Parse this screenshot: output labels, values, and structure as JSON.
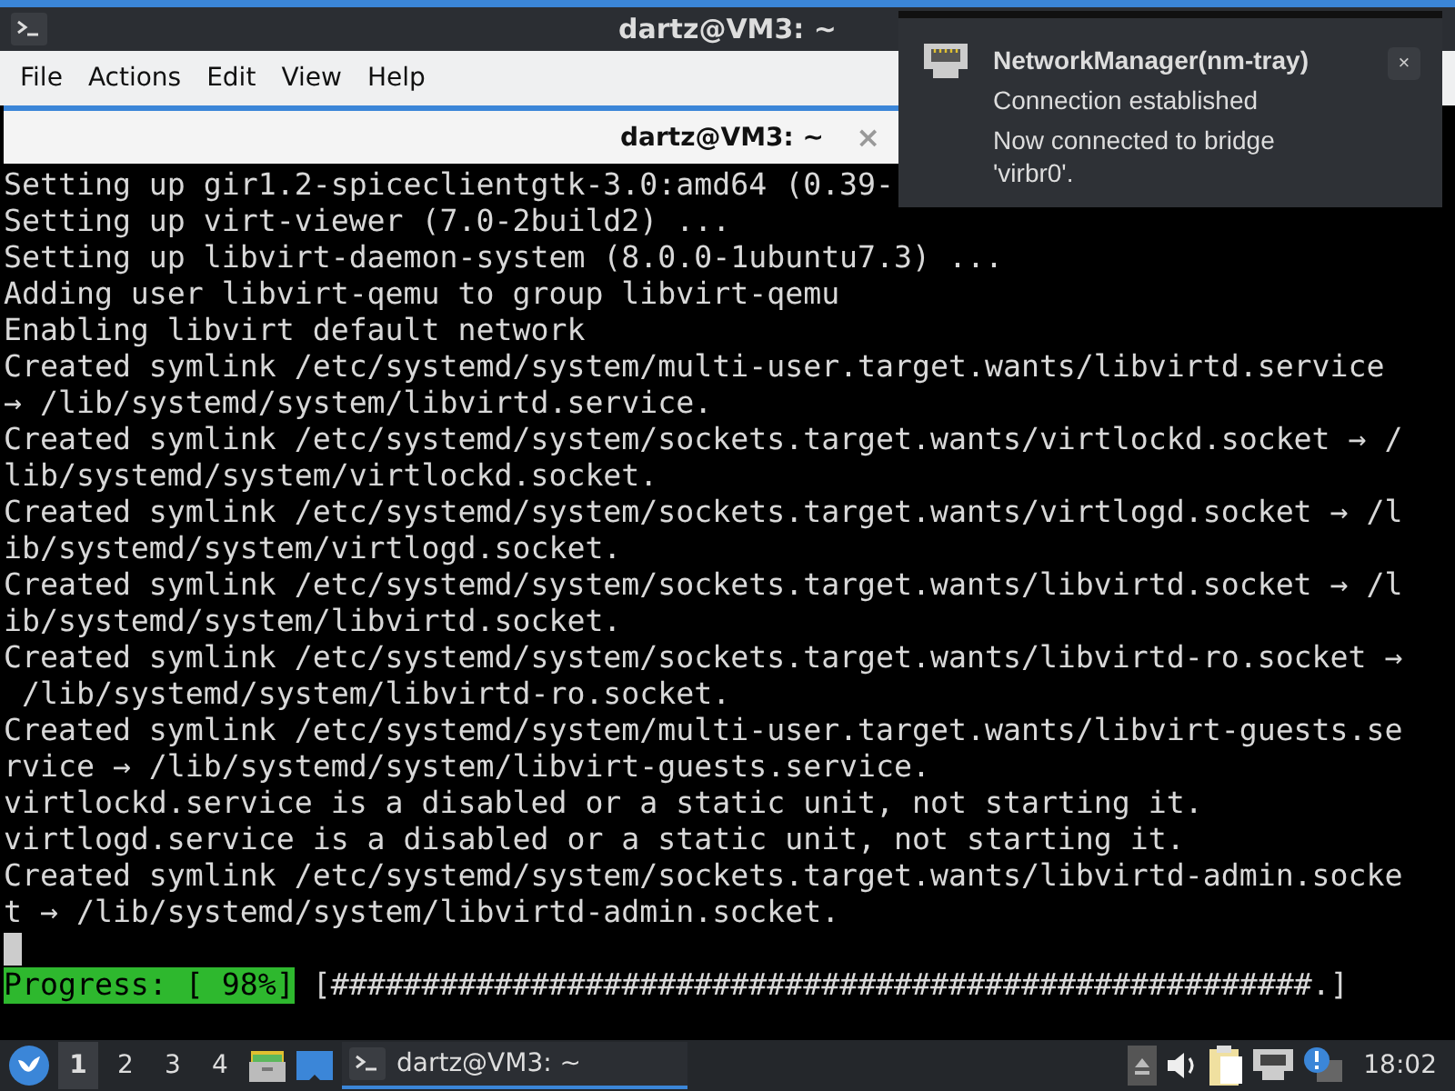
{
  "window": {
    "title": "dartz@VM3: ~"
  },
  "menu": [
    "File",
    "Actions",
    "Edit",
    "View",
    "Help"
  ],
  "tabs": [
    {
      "label": "dartz@VM3: ~",
      "selected": true,
      "close": "×"
    }
  ],
  "terminal": {
    "lines": [
      "Setting up gir1.2-spiceclientgtk-3.0:amd64 (0.39-",
      "Setting up virt-viewer (7.0-2build2) ...",
      "Setting up libvirt-daemon-system (8.0.0-1ubuntu7.3) ...",
      "Adding user libvirt-qemu to group libvirt-qemu",
      "Enabling libvirt default network",
      "Created symlink /etc/systemd/system/multi-user.target.wants/libvirtd.service",
      "→ /lib/systemd/system/libvirtd.service.",
      "Created symlink /etc/systemd/system/sockets.target.wants/virtlockd.socket → /",
      "lib/systemd/system/virtlockd.socket.",
      "Created symlink /etc/systemd/system/sockets.target.wants/virtlogd.socket → /l",
      "ib/systemd/system/virtlogd.socket.",
      "Created symlink /etc/systemd/system/sockets.target.wants/libvirtd.socket → /l",
      "ib/systemd/system/libvirtd.socket.",
      "Created symlink /etc/systemd/system/sockets.target.wants/libvirtd-ro.socket →",
      " /lib/systemd/system/libvirtd-ro.socket.",
      "Created symlink /etc/systemd/system/multi-user.target.wants/libvirt-guests.se",
      "rvice → /lib/systemd/system/libvirt-guests.service.",
      "virtlockd.service is a disabled or a static unit, not starting it.",
      "virtlogd.service is a disabled or a static unit, not starting it.",
      "Created symlink /etc/systemd/system/sockets.target.wants/libvirtd-admin.socke",
      "t → /lib/systemd/system/libvirtd-admin.socket."
    ],
    "progress_label": "Progress: [ 98%]",
    "progress_bar": "[######################################################.]"
  },
  "notification": {
    "title": "NetworkManager(nm-tray)",
    "summary": "Connection established",
    "body": "Now connected to bridge 'virbr0'.",
    "close": "×"
  },
  "taskbar": {
    "workspaces": [
      {
        "label": "1",
        "selected": true
      },
      {
        "label": "2",
        "selected": false
      },
      {
        "label": "3",
        "selected": false
      },
      {
        "label": "4",
        "selected": false
      }
    ],
    "tasks": [
      {
        "label": "dartz@VM3: ~",
        "selected": true
      }
    ],
    "clock": "18:02"
  }
}
